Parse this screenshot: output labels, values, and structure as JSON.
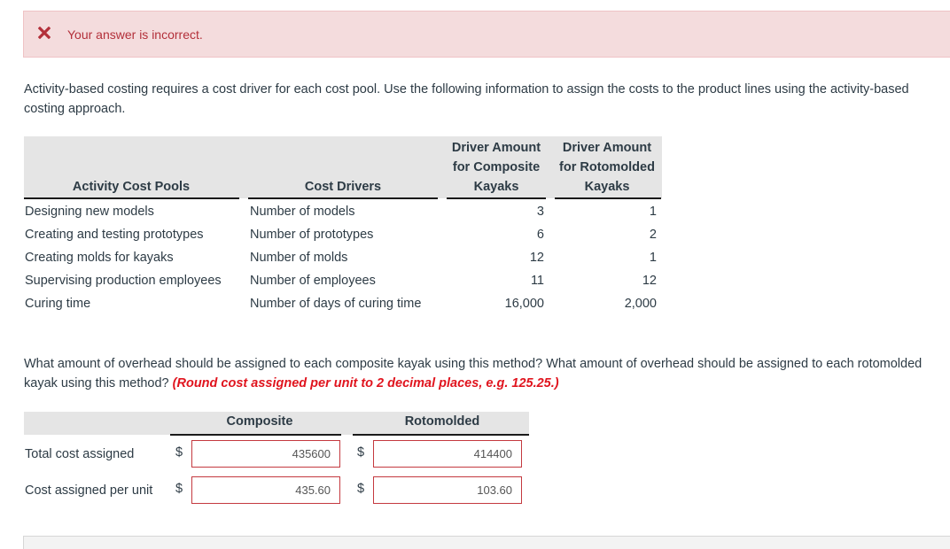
{
  "feedback": {
    "icon": "x-icon",
    "message": "Your answer is incorrect.",
    "color": "#b3303a",
    "background": "#f4dcdd"
  },
  "intro_text": "Activity-based costing requires a cost driver for each cost pool. Use the following information to assign the costs to the product lines using the activity-based costing approach.",
  "driver_table": {
    "headers": {
      "pools": "Activity Cost Pools",
      "drivers": "Cost Drivers",
      "composite_line1": "Driver Amount",
      "composite_line2": "for Composite",
      "composite_line3": "Kayaks",
      "roto_line1": "Driver Amount",
      "roto_line2": "for Rotomolded",
      "roto_line3": "Kayaks"
    },
    "rows": [
      {
        "pool": "Designing new models",
        "driver": "Number of models",
        "composite": "3",
        "rotomolded": "1"
      },
      {
        "pool": "Creating and testing prototypes",
        "driver": "Number of prototypes",
        "composite": "6",
        "rotomolded": "2"
      },
      {
        "pool": "Creating molds for kayaks",
        "driver": "Number of molds",
        "composite": "12",
        "rotomolded": "1"
      },
      {
        "pool": "Supervising production employees",
        "driver": "Number of employees",
        "composite": "11",
        "rotomolded": "12"
      },
      {
        "pool": "Curing time",
        "driver": "Number of days of curing time",
        "composite": "16,000",
        "rotomolded": "2,000"
      }
    ]
  },
  "question": {
    "text": "What amount of overhead should be assigned to each composite kayak using this method? What amount of overhead should be assigned to each rotomolded kayak using this method? ",
    "note": "(Round cost assigned per unit to 2 decimal places, e.g. 125.25.)",
    "note_color": "#e0141e"
  },
  "answer_table": {
    "col_composite": "Composite",
    "col_rotomolded": "Rotomolded",
    "currency": "$",
    "rows": [
      {
        "label": "Total cost assigned",
        "composite": "435600",
        "rotomolded": "414400"
      },
      {
        "label": "Cost assigned per unit",
        "composite": "435.60",
        "rotomolded": "103.60"
      }
    ],
    "input_border_color": "#c4393f"
  }
}
